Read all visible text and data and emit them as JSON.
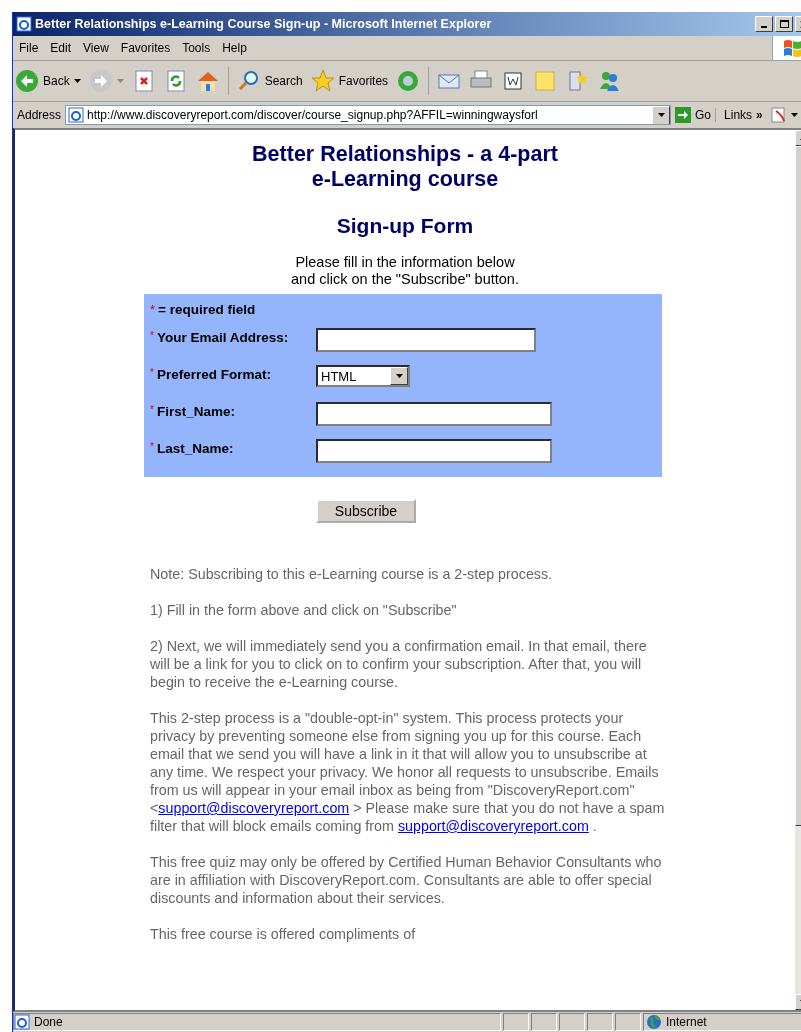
{
  "window": {
    "title": "Better Relationships e-Learning Course Sign-up - Microsoft Internet Explorer"
  },
  "menu": [
    "File",
    "Edit",
    "View",
    "Favorites",
    "Tools",
    "Help"
  ],
  "toolbar": {
    "back": "Back",
    "search": "Search",
    "favorites": "Favorites"
  },
  "address": {
    "label": "Address",
    "url": "http://www.discoveryreport.com/discover/course_signup.php?AFFIL=winningwaysforl",
    "go": "Go",
    "links": "Links",
    "more": "»"
  },
  "page": {
    "title_lines": [
      "Better Relationships - a 4-part",
      "e-Learning course"
    ],
    "form_title": "Sign-up Form",
    "intro_lines": [
      "Please fill in the information below",
      "and click on the \"Subscribe\" button."
    ],
    "required_mark": "*",
    "required_note": "= required field",
    "fields": [
      {
        "kind": "email",
        "label": "Your Email Address:"
      },
      {
        "kind": "select",
        "label": "Preferred Format:",
        "value": "HTML"
      },
      {
        "kind": "text",
        "label": "First_Name:"
      },
      {
        "kind": "text",
        "label": "Last_Name:"
      }
    ],
    "submit": "Subscribe",
    "paragraphs": [
      [
        {
          "kind": "text",
          "text": "Note: Subscribing to this e-Learning course is a 2-step process."
        }
      ],
      [
        {
          "kind": "text",
          "text": "1) Fill in the form above and click on \"Subscribe\""
        }
      ],
      [
        {
          "kind": "text",
          "text": "2) Next, we will immediately send you a confirmation email. In that email, there will be a link for you to click on to confirm your subscription. After that, you will begin to receive the e-Learning course."
        }
      ],
      [
        {
          "kind": "text",
          "text": "This 2-step process is a \"double-opt-in\" system. This process protects your privacy by preventing someone else from signing you up for this course. Each email that we send you will have a link in it that will allow you to unsubscribe at any time. We respect your privacy. We honor all requests to unsubscribe. Emails from us will appear in your email inbox as being from \"DiscoveryReport.com\" <"
        },
        {
          "kind": "link",
          "text": "support@discoveryreport.com"
        },
        {
          "kind": "text",
          "text": " >   Please make sure that you do not have a spam filter that will block emails coming from "
        },
        {
          "kind": "link",
          "text": "support@discoveryreport.com"
        },
        {
          "kind": "text",
          "text": " ."
        }
      ],
      [
        {
          "kind": "text",
          "text": "This free quiz may only be offered by Certified Human Behavior Consultants who are in affiliation with DiscoveryReport.com. Consultants are able to offer special discounts and information about their services."
        }
      ],
      [
        {
          "kind": "text",
          "text": "This free course is offered compliments of"
        }
      ]
    ]
  },
  "status_bar": {
    "text": "Done",
    "zone": "Internet"
  }
}
